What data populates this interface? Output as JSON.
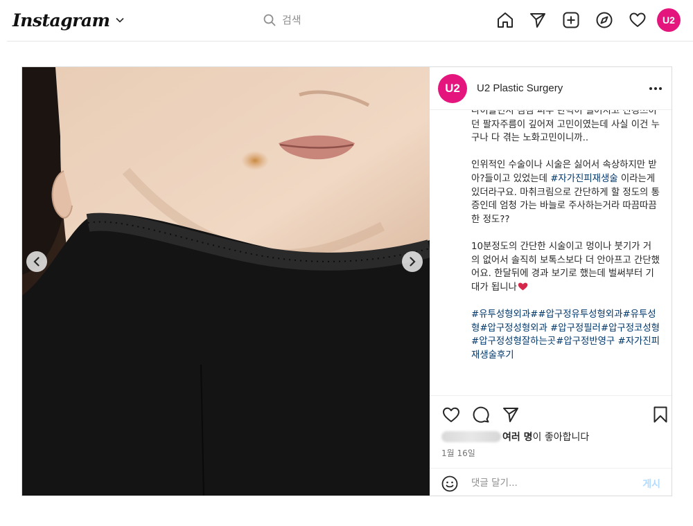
{
  "nav": {
    "logo": "Instagram",
    "search_placeholder": "검색",
    "avatar_label": "U2",
    "icons": [
      "home-icon",
      "paper-plane-icon",
      "new-post-icon",
      "explore-compass-icon",
      "heart-icon"
    ]
  },
  "post": {
    "account": {
      "avatar_label": "U2",
      "name": "U2 Plastic Surgery"
    },
    "more_icon": "ellipsis-icon",
    "caption": {
      "paragraphs": [
        {
          "text": "나이들면서 점점 피부 탄력이 떨어지고 신경쓰이던 팔자주름이 깊어져 고민이였는데 사실 이건 누구나 다 겪는 노화고민이니까.."
        },
        {
          "before": "인위적인 수술이나 시술은 싫어서 속상하지만 받아?들이고 있었는데 ",
          "tag": "#자가진피재생술",
          "after": " 이라는게 있더라구요. 마취크림으로 간단하게 할 정도의 통증인데 엄청 가는 바늘로 주사하는거라 따끔따끔한 정도??"
        },
        {
          "text": "10분정도의 간단한 시술이고 멍이나 붓기가 거의 없어서 솔직히 보톡스보다 더 안아프고 간단했어요. 한달뒤에 경과 보기로 했는데 벌써부터 기대가 됩니나"
        }
      ],
      "hashtags": "#유투성형외과##압구정유투성형외과#유투성형#압구정성형외과 #압구정필러#압구정코성형#압구정성형잘하는곳#압구정반영구 #자가진피재생술후기"
    },
    "likes_text": "여러 명",
    "likes_suffix": "이 좋아합니다",
    "date": "1월 16일",
    "comment_placeholder": "댓글 달기...",
    "post_button": "게시",
    "action_icons": [
      "like-heart-icon",
      "comment-bubble-icon",
      "share-plane-icon",
      "bookmark-icon",
      "emoji-smile-icon"
    ],
    "carousel": [
      "chevron-left-icon",
      "chevron-right-icon"
    ]
  },
  "colors": {
    "brand_pink": "#e4157d",
    "hashtag": "#00376b",
    "post_button_disabled": "#b3dbff",
    "border": "#dbdbdb"
  }
}
